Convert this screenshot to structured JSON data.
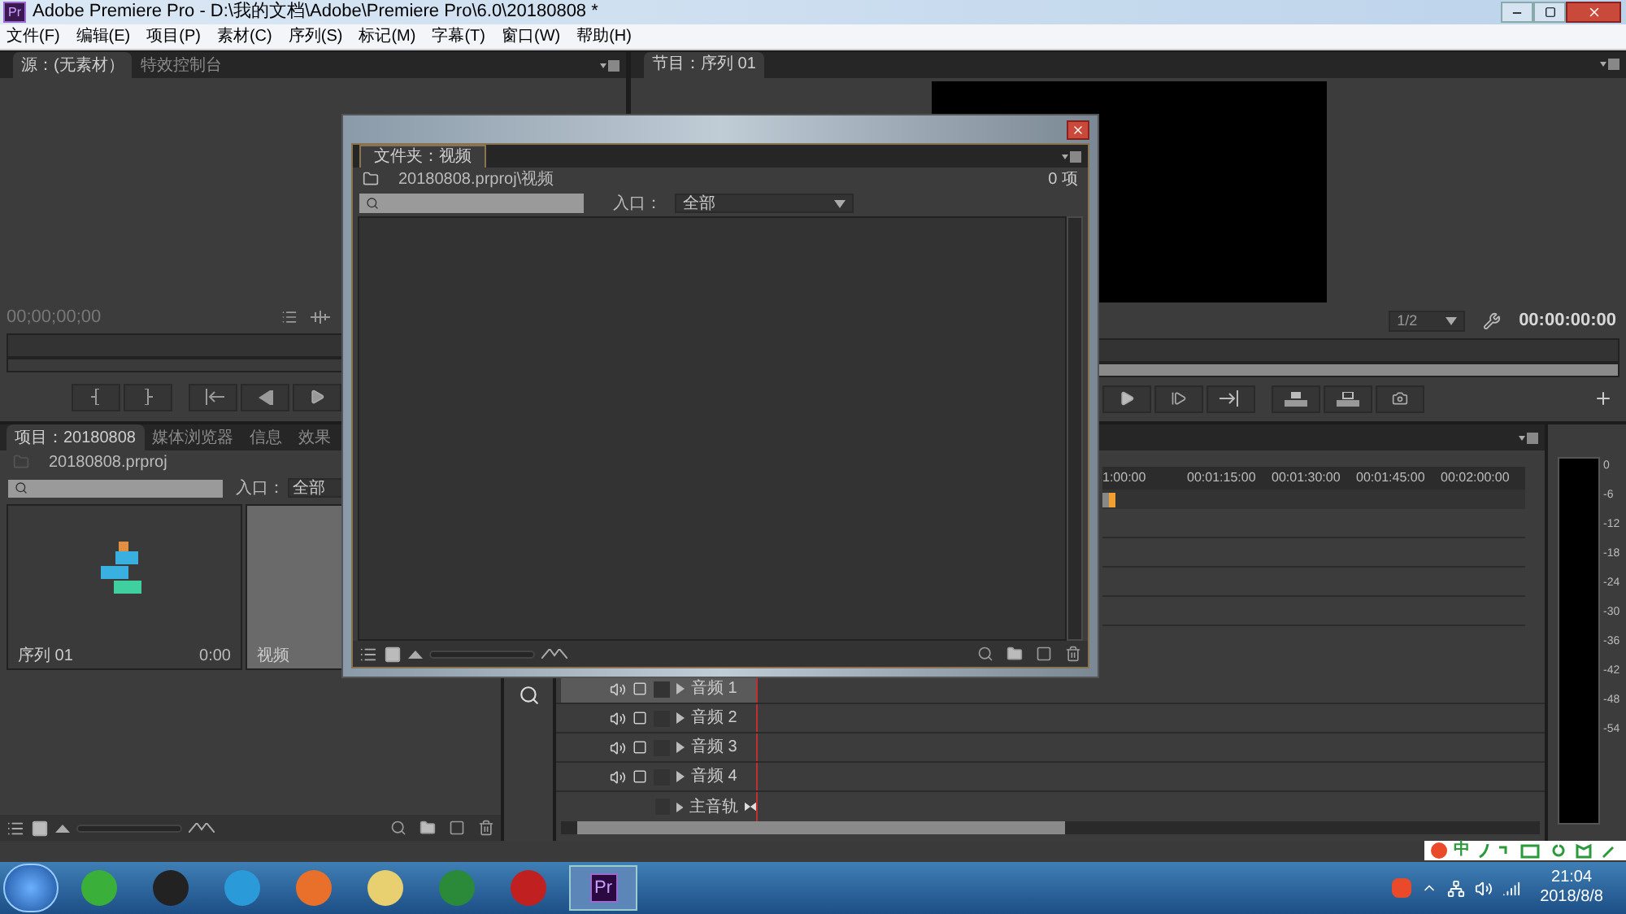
{
  "window": {
    "logo": "Pr",
    "title": "Adobe Premiere Pro - D:\\我的文档\\Adobe\\Premiere Pro\\6.0\\20180808 *"
  },
  "menu": [
    "文件(F)",
    "编辑(E)",
    "项目(P)",
    "素材(C)",
    "序列(S)",
    "标记(M)",
    "字幕(T)",
    "窗口(W)",
    "帮助(H)"
  ],
  "source_panel": {
    "tabs": [
      {
        "label": "源：(无素材）",
        "selected": true
      },
      {
        "label": "特效控制台",
        "selected": false
      }
    ],
    "timecode": "00;00;00;00"
  },
  "program_panel": {
    "tabs": [
      {
        "label": "节目：序列 01",
        "selected": true
      }
    ],
    "zoom": "1/2",
    "timecode": "00:00:00:00"
  },
  "project_panel": {
    "tabs": [
      {
        "label": "项目：20180808",
        "selected": true
      },
      {
        "label": "媒体浏览器",
        "selected": false
      },
      {
        "label": "信息",
        "selected": false
      },
      {
        "label": "效果",
        "selected": false
      }
    ],
    "path": "20180808.prproj",
    "filter_label": "入口：",
    "filter_value": "全部",
    "items": [
      {
        "kind": "sequence",
        "name": "序列 01",
        "duration": "0:00",
        "selected": false
      },
      {
        "kind": "bin",
        "name": "视频",
        "selected": true
      }
    ]
  },
  "folder_dialog": {
    "tab": "文件夹：视频",
    "path": "20180808.prproj\\视频",
    "count": "0 项",
    "filter_label": "入口：",
    "filter_value": "全部"
  },
  "timeline": {
    "ruler": [
      "1:00:00",
      "00:01:15:00",
      "00:01:30:00",
      "00:01:45:00",
      "00:02:00:00"
    ],
    "audio_tracks": [
      {
        "name": "音频 1",
        "selected": true
      },
      {
        "name": "音频 2",
        "selected": false
      },
      {
        "name": "音频 3",
        "selected": false
      },
      {
        "name": "音频 4",
        "selected": false
      }
    ],
    "master_track": "主音轨"
  },
  "meters": {
    "scale": [
      "0",
      "-6",
      "-12",
      "-18",
      "-24",
      "-30",
      "-36",
      "-42",
      "-48",
      "-54"
    ]
  },
  "ime": {
    "mode": "中"
  },
  "taskbar": {
    "pinned_label": "Pr",
    "time": "21:04",
    "date": "2018/8/8"
  }
}
